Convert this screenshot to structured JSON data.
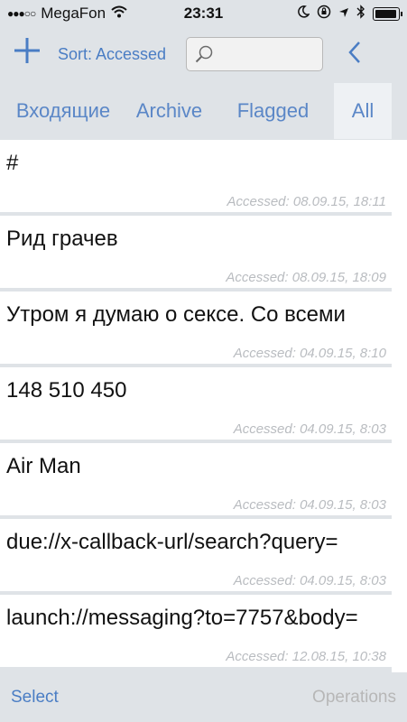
{
  "status_bar": {
    "signal": "●●●○○",
    "carrier": "MegaFon",
    "time": "23:31"
  },
  "toolbar": {
    "add_icon": "plus-icon",
    "sort_label": "Sort: Accessed",
    "search_placeholder": "",
    "back_icon": "chevron-left-icon"
  },
  "tabs": [
    {
      "label": "Входящие"
    },
    {
      "label": "Archive"
    },
    {
      "label": "Flagged"
    },
    {
      "label": "All",
      "selected": true
    }
  ],
  "items": [
    {
      "title": "#",
      "meta": "Accessed: 08.09.15, 18:11"
    },
    {
      "title": "Рид грачев",
      "meta": "Accessed: 08.09.15, 18:09"
    },
    {
      "title": "Утром я думаю о сексе. Со всеми",
      "meta": "Accessed: 04.09.15, 8:10"
    },
    {
      "title": "148 510 450",
      "meta": "Accessed: 04.09.15, 8:03"
    },
    {
      "title": "Air Man",
      "meta": "Accessed: 04.09.15, 8:03"
    },
    {
      "title": "due://x-callback-url/search?query=",
      "meta": "Accessed: 04.09.15, 8:03"
    },
    {
      "title": "launch://messaging?to=7757&body=",
      "meta": "Accessed: 12.08.15, 10:38"
    }
  ],
  "bottom_bar": {
    "select_label": "Select",
    "operations_label": "Operations"
  }
}
